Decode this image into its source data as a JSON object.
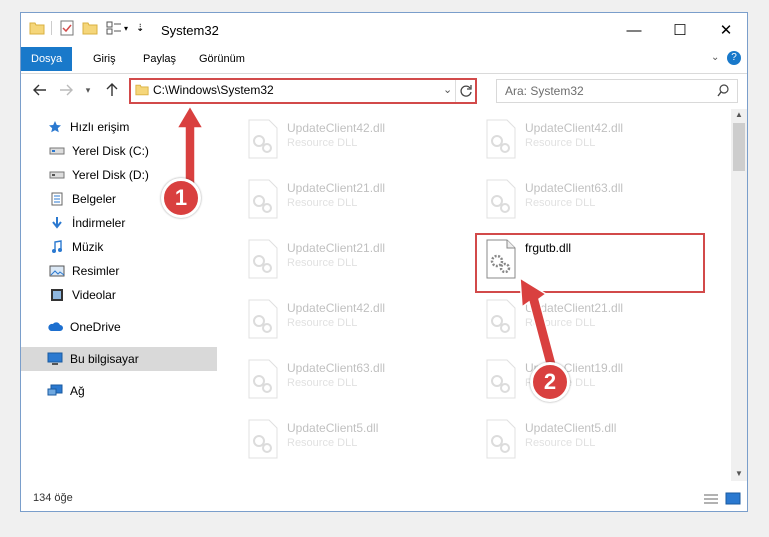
{
  "window": {
    "title": "System32"
  },
  "ribbon": {
    "tabs": [
      "Dosya",
      "Giriş",
      "Paylaş",
      "Görünüm"
    ]
  },
  "address": {
    "path": "C:\\Windows\\System32"
  },
  "search": {
    "placeholder": "Ara: System32"
  },
  "sidebar": {
    "items": [
      {
        "label": "Hızlı erişim",
        "icon": "star-icon"
      },
      {
        "label": "Yerel Disk (C:)",
        "icon": "drive-icon"
      },
      {
        "label": "Yerel Disk (D:)",
        "icon": "drive-icon"
      },
      {
        "label": "Belgeler",
        "icon": "documents-icon"
      },
      {
        "label": "İndirmeler",
        "icon": "download-icon"
      },
      {
        "label": "Müzik",
        "icon": "music-icon"
      },
      {
        "label": "Resimler",
        "icon": "pictures-icon"
      },
      {
        "label": "Videolar",
        "icon": "video-icon"
      },
      {
        "label": "OneDrive",
        "icon": "cloud-icon"
      },
      {
        "label": "Bu bilgisayar",
        "icon": "computer-icon"
      },
      {
        "label": "Ağ",
        "icon": "network-icon"
      }
    ]
  },
  "files": {
    "col1": [
      {
        "name": "UpdateClient42.dll",
        "type": "Resource DLL"
      },
      {
        "name": "UpdateClient21.dll",
        "type": "Resource DLL"
      },
      {
        "name": "UpdateClient21.dll",
        "type": "Resource DLL"
      },
      {
        "name": "UpdateClient42.dll",
        "type": "Resource DLL"
      },
      {
        "name": "UpdateClient63.dll",
        "type": "Resource DLL"
      },
      {
        "name": "UpdateClient5.dll",
        "type": "Resource DLL"
      }
    ],
    "col2": [
      {
        "name": "UpdateClient42.dll",
        "type": "Resource DLL"
      },
      {
        "name": "UpdateClient63.dll",
        "type": "Resource DLL"
      },
      {
        "name": "frgutb.dll",
        "type": ""
      },
      {
        "name": "UpdateClient21.dll",
        "type": "Resource DLL"
      },
      {
        "name": "UpdateClient19.dll",
        "type": "Resource DLL"
      },
      {
        "name": "UpdateClient5.dll",
        "type": "Resource DLL"
      }
    ]
  },
  "status": {
    "count": "134 öğe"
  },
  "annotations": {
    "step1": "1",
    "step2": "2",
    "color": "#d9403f"
  }
}
